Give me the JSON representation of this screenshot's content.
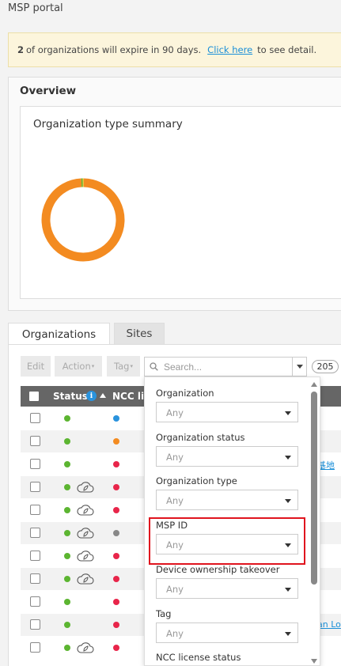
{
  "header": {
    "title": "MSP portal"
  },
  "banner": {
    "count": "2",
    "text": "of organizations will expire in 90 days.",
    "link_label": "Click here",
    "suffix": "to see detail."
  },
  "overview": {
    "title": "Overview",
    "org_type_summary": {
      "title": "Organization type summary"
    }
  },
  "chart_data": {
    "type": "pie",
    "donut": true,
    "title": "Organization type summary",
    "slices": [
      {
        "value": 99,
        "color": "#f38b21"
      },
      {
        "value": 0.5,
        "color": "#5cb531"
      },
      {
        "value": 0.5,
        "color": "#e8c13a"
      }
    ]
  },
  "tabs": [
    {
      "label": "Organizations",
      "active": true
    },
    {
      "label": "Sites",
      "active": false
    }
  ],
  "toolbar": {
    "edit_label": "Edit",
    "action_label": "Action",
    "tag_label": "Tag",
    "search_placeholder": "Search...",
    "count": "205"
  },
  "table": {
    "columns": {
      "status": "Status",
      "ncc": "NCC lic"
    },
    "rows": [
      {
        "cloud": false,
        "ncc_color": "#2a93dd",
        "link": ""
      },
      {
        "cloud": false,
        "ncc_color": "#f38b21",
        "link": ""
      },
      {
        "cloud": false,
        "ncc_color": "#e8254a",
        "link": "基地"
      },
      {
        "cloud": true,
        "ncc_color": "#e8254a",
        "link": ""
      },
      {
        "cloud": true,
        "ncc_color": "#e8254a",
        "link": ""
      },
      {
        "cloud": true,
        "ncc_color": "#888888",
        "link": ""
      },
      {
        "cloud": true,
        "ncc_color": "#e8254a",
        "link": ""
      },
      {
        "cloud": true,
        "ncc_color": "#e8254a",
        "link": ""
      },
      {
        "cloud": false,
        "ncc_color": "#e8254a",
        "link": ""
      },
      {
        "cloud": false,
        "ncc_color": "#e8254a",
        "link": "an Lo"
      },
      {
        "cloud": true,
        "ncc_color": "#e8254a",
        "link": ""
      }
    ]
  },
  "filters": [
    {
      "label": "Organization",
      "value": "Any"
    },
    {
      "label": "Organization status",
      "value": "Any"
    },
    {
      "label": "Organization type",
      "value": "Any"
    },
    {
      "label": "MSP ID",
      "value": "Any"
    },
    {
      "label": "Device ownership takeover",
      "value": "Any"
    },
    {
      "label": "Tag",
      "value": "Any"
    },
    {
      "label": "NCC license status",
      "value": ""
    }
  ],
  "colors": {
    "accent": "#1a8fd8",
    "status_ok": "#5cb531",
    "highlight": "#e0141e"
  }
}
